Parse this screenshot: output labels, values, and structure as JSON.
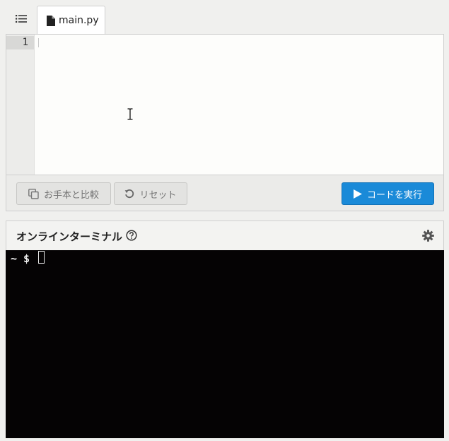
{
  "tab": {
    "filename": "main.py"
  },
  "editor": {
    "line_numbers": [
      "1"
    ]
  },
  "toolbar": {
    "compare_label": "お手本と比較",
    "reset_label": "リセット",
    "run_label": "コードを実行"
  },
  "terminal": {
    "title": "オンラインターミナル",
    "prompt": "~ $"
  },
  "colors": {
    "run_button": "#1a8ad8",
    "terminal_bg": "#050304",
    "page_bg": "#f0f0ee"
  },
  "icons": [
    "list-icon",
    "file-icon",
    "copy-icon",
    "undo-icon",
    "play-icon",
    "help-icon",
    "gear-icon"
  ]
}
